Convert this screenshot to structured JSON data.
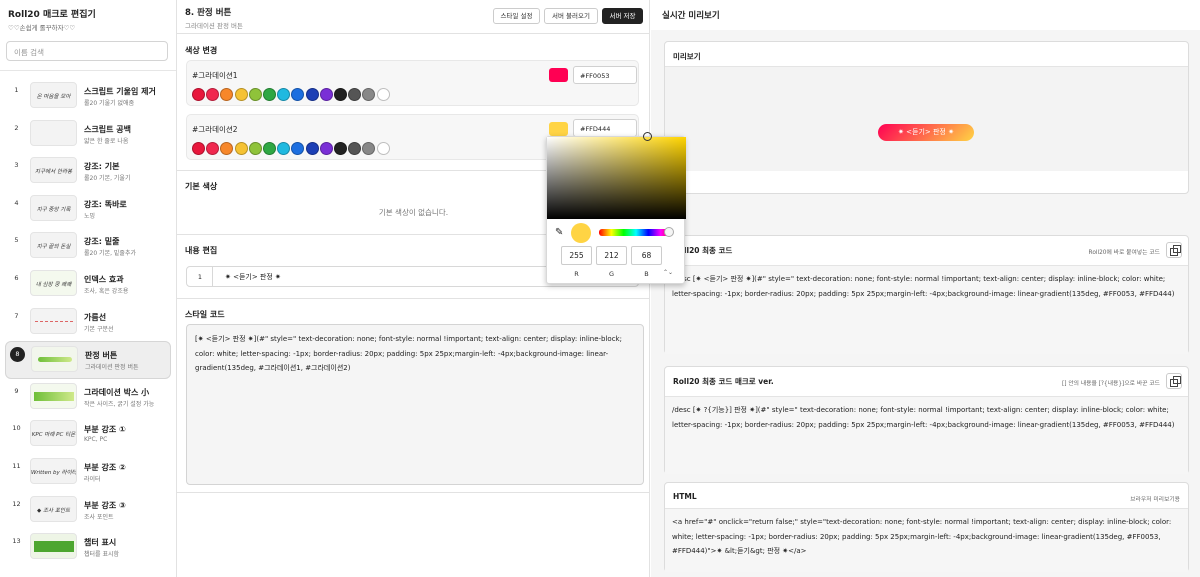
{
  "sidebar": {
    "title": "Roll20 매크로 편집기",
    "subtitle": "♡♡손쉽게 롤꾸하자♡♡",
    "search_placeholder": "이름 검색",
    "items": [
      {
        "num": "1",
        "name": "스크립트 기울임 제거",
        "desc": "롤20 기울기 없애줌",
        "thumb": "온 마음을 모아"
      },
      {
        "num": "2",
        "name": "스크립트 공백",
        "desc": "얇은 한 줄로 나옴",
        "thumb": ""
      },
      {
        "num": "3",
        "name": "강조: 기본",
        "desc": "롤20 기본, 기울기",
        "thumb": "지구에서 한라봉"
      },
      {
        "num": "4",
        "name": "강조: 똑바로",
        "desc": "노밍",
        "thumb": "지구 중앙 기록"
      },
      {
        "num": "5",
        "name": "강조: 밑줄",
        "desc": "롤20 기본, 밑줄추가",
        "thumb": "지구 끝의 돈실"
      },
      {
        "num": "6",
        "name": "인덱스 효과",
        "desc": "조사, 혹은 강조용",
        "thumb": "내 심장 쿵 쾌쾌"
      },
      {
        "num": "7",
        "name": "가름선",
        "desc": "기본 구분선",
        "thumb": ""
      },
      {
        "num": "8",
        "name": "판정 버튼",
        "desc": "그라데이션 판정 버튼",
        "thumb": ""
      },
      {
        "num": "9",
        "name": "그라데이션 박스 小",
        "desc": "작은 사이즈, 굵기 설정 가능",
        "thumb": ""
      },
      {
        "num": "10",
        "name": "부분 강조 ①",
        "desc": "KPC, PC",
        "thumb": "KPC 마례   PC 티몬"
      },
      {
        "num": "11",
        "name": "부분 강조 ②",
        "desc": "라이터",
        "thumb": "Written by 라이터"
      },
      {
        "num": "12",
        "name": "부분 강조 ③",
        "desc": "조사 포인트",
        "thumb": "◆ 조사 포인트"
      },
      {
        "num": "13",
        "name": "챕터 표시",
        "desc": "챕터를 표시함",
        "thumb": "챕터"
      }
    ]
  },
  "center": {
    "title": "8. 판정 버튼",
    "subtitle": "그라데이션 판정 버튼",
    "buttons": {
      "style": "스타일 설정",
      "load": "서버 불러오기",
      "save": "서버 저장"
    },
    "color_section": "색상 변경",
    "gradient1": {
      "label": "#그라데이션1",
      "hex": "#FF0053",
      "color": "#FF0053"
    },
    "gradient2": {
      "label": "#그라데이션2",
      "hex": "#FFD444",
      "color": "#FFD444"
    },
    "palette": [
      "#e8173c",
      "#f0284f",
      "#f7872a",
      "#f5c233",
      "#8fc33a",
      "#2fa743",
      "#1fb9e0",
      "#1d6fe0",
      "#1c3fb5",
      "#7a2fd6",
      "#222222",
      "#555555",
      "#888888",
      "#ffffff"
    ],
    "basic_section": "기본 색상",
    "basic_empty": "기본 색상이 없습니다.",
    "content_section": "내용 편집",
    "content_row": {
      "num": "1",
      "text": "✷     <듣기> 판정     ✷"
    },
    "style_section": "스타일 코드",
    "style_code": "[✷     <듣기> 판정     ✷](#\" style=\" text-decoration: none; font-style: normal !important; text-align: center; display: inline-block; color: white; letter-spacing: -1px; border-radius: 20px; padding: 5px 25px;margin-left: -4px;background-image: linear-gradient(135deg, #그라데이션1, #그라데이션2)"
  },
  "picker": {
    "r": "255",
    "g": "212",
    "b": "68",
    "r_label": "R",
    "g_label": "G",
    "b_label": "B",
    "eyedropper_glyph": "✎",
    "arrows": "⌃⌄"
  },
  "preview": {
    "header": "실시간 미리보기",
    "panel_title": "미리보기",
    "button_text": "✷     <듣기> 판정     ✷",
    "final": {
      "title": "Roll20 최종 코드",
      "note": "Roll20에 바로 붙여넣는 코드",
      "code": "/desc [✷     <듣기> 판정     ✷](#\" style=\" text-decoration: none; font-style: normal !important; text-align: center; display: inline-block; color: white; letter-spacing: -1px; border-radius: 20px; padding: 5px 25px;margin-left: -4px;background-image: linear-gradient(135deg, #FF0053, #FFD444)"
    },
    "macro": {
      "title": "Roll20 최종 코드 매크로 ver.",
      "note": "[] 안의 내용을 [?{내용}]으로 바꾼 코드",
      "code": "/desc [✷     ?{기능}] 판정     ✷](#\" style=\" text-decoration: none; font-style: normal !important; text-align: center; display: inline-block; color: white; letter-spacing: -1px; border-radius: 20px; padding: 5px 25px;margin-left: -4px;background-image: linear-gradient(135deg, #FF0053, #FFD444)"
    },
    "html": {
      "title": "HTML",
      "note": "브라우저 미리보기용",
      "code": "<a href=\"#\" onclick=\"return false;\" style=\"text-decoration: none; font-style: normal !important; text-align: center; display: inline-block; color: white; letter-spacing: -1px; border-radius: 20px; padding: 5px 25px;margin-left: -4px;background-image: linear-gradient(135deg, #FF0053, #FFD444)\">✷     &lt;듣기&gt; 판정     ✷</a>"
    }
  }
}
